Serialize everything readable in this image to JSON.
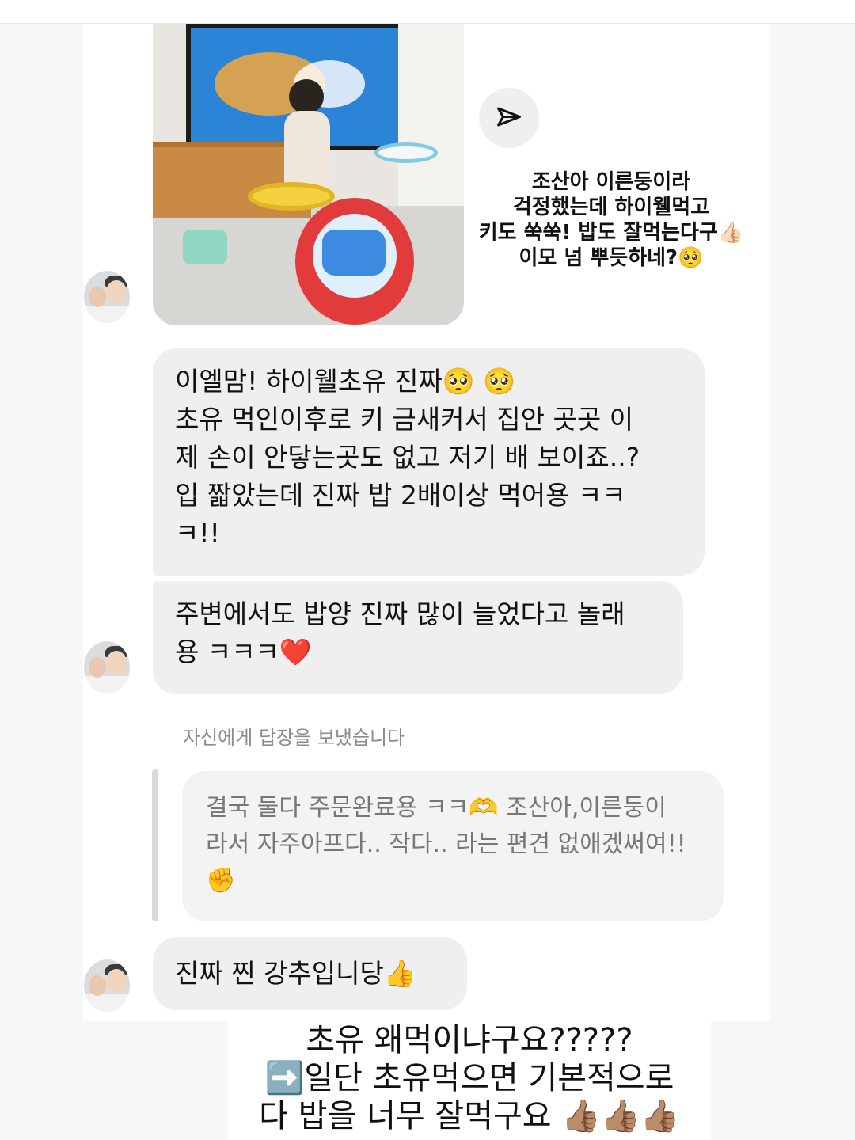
{
  "caption": {
    "lines": [
      "조산아 이른둥이라",
      "걱정했는데 하이웰먹고",
      "키도 쑥쑥! 밥도 잘먹는다구👍🏻",
      "이모 넘 뿌듯하네?🥺"
    ]
  },
  "messages": {
    "first": {
      "lines": [
        "이엘맘! 하이웰초유 진짜🥺 🥺",
        "초유 먹인이후로 키 금새커서 집안 곳곳 이",
        "제 손이 안닿는곳도 없고 저기 배 보이죠..?",
        "입 짧았는데 진짜 밥 2배이상 먹어용 ㅋㅋ",
        "ㅋ!!"
      ]
    },
    "second": {
      "lines": [
        "주변에서도 밥양 진짜 많이 늘었다고 놀래",
        "용 ㅋㅋㅋ❤️"
      ]
    },
    "reply_label": "자신에게 답장을 보냈습니다",
    "quoted": {
      "lines": [
        "결국 둘다 주문완료용 ㅋㅋ🫶 조산아,이른둥이",
        "라서 자주아프다.. 작다.. 라는 편견 없애겠써여!!",
        "✊"
      ]
    },
    "third": "진짜 찐 강추입니당👍"
  },
  "bottom": {
    "lines": [
      "초유 왜먹이냐구요?????",
      "➡️일단 초유먹으면 기본적으로",
      "다 밥을 너무 잘먹구요 👍🏽👍🏽👍🏽"
    ]
  },
  "icons": {
    "share": "paper-plane-icon"
  },
  "colors": {
    "bubble": "#efefef",
    "quote": "#f3f3f3",
    "background": "#f7f7f7"
  }
}
